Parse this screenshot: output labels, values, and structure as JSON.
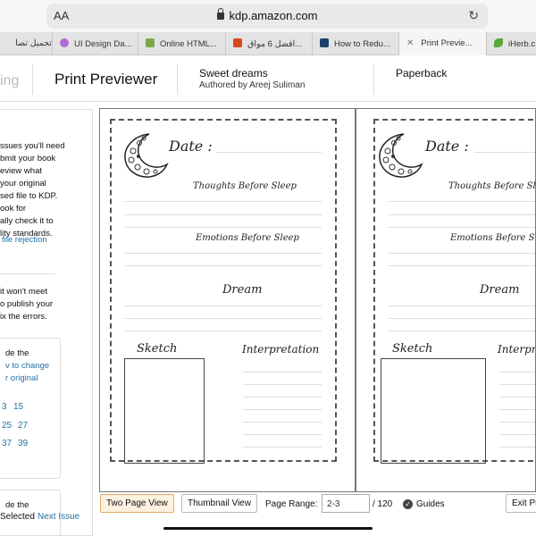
{
  "browser": {
    "text_size_label": "AA",
    "url": "kdp.amazon.com",
    "tabs": [
      {
        "label": "تحميل تصا",
        "color": "#ffffff"
      },
      {
        "label": "UI Design Da...",
        "color": "#b36bd4"
      },
      {
        "label": "Online HTML...",
        "color": "#7aa84a"
      },
      {
        "label": "افضل 6 مواق...",
        "color": "#d44a1e"
      },
      {
        "label": "How to Redu...",
        "color": "#1b3f6b"
      },
      {
        "label": "Print Previe...",
        "color": "#888888"
      },
      {
        "label": "iHerb.c",
        "color": "#5aa83b"
      }
    ]
  },
  "header": {
    "brand_fragment": "ing",
    "title": "Print Previewer",
    "book_title": "Sweet dreams",
    "author": "Authored by Areej Suliman",
    "format": "Paperback"
  },
  "left_panel": {
    "lines": [
      "ssues you'll need",
      "bmit your book",
      "eview what",
      "your original",
      "sed file to KDP.",
      "ook for",
      "ally check it to",
      "lity standards."
    ],
    "link1": "file rejection",
    "lines2": [
      "it won't meet",
      "o publish your",
      "ix the errors."
    ],
    "box1_text": "de the",
    "box1_link1": "v to change",
    "box1_link2": "r original",
    "page_numbers": [
      "3",
      "15",
      "25",
      "27",
      "37",
      "39"
    ],
    "box2_text": "de the"
  },
  "pages": {
    "date_label": "Date :",
    "thoughts_label": "Thoughts Before Sleep",
    "emotions_label": "Emotions Before Sleep",
    "dream_label": "Dream",
    "sketch_label": "Sketch",
    "interpretation_label": "Interpretation",
    "interp_cut": "Interpr"
  },
  "toolbar": {
    "two_page": "Two Page View",
    "thumbnail": "Thumbnail View",
    "range_label": "Page Range:",
    "range_value": "2-3",
    "range_total": "/ 120",
    "guides": "Guides",
    "exit": "Exit Pr"
  },
  "status": {
    "selected": "Selected",
    "next": "Next Issue"
  }
}
